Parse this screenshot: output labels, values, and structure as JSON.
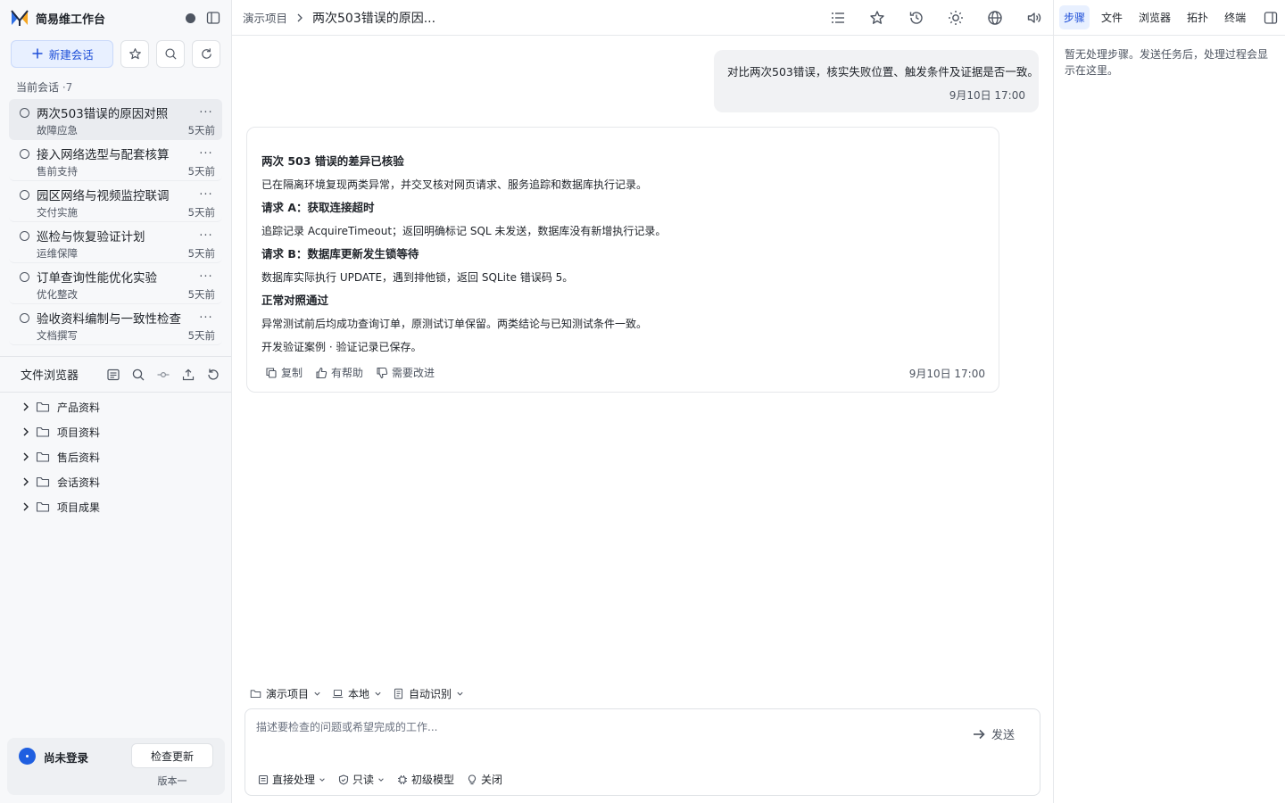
{
  "brand": {
    "name": "简易维工作台"
  },
  "sidebar": {
    "new_chat_label": "新建会话",
    "section_label": "当前会话",
    "section_count": "·7",
    "sessions": [
      {
        "title": "两次503错误的原因对照",
        "tag": "故障应急",
        "time": "5天前",
        "active": true
      },
      {
        "title": "接入网络选型与配套核算",
        "tag": "售前支持",
        "time": "5天前"
      },
      {
        "title": "园区网络与视频监控联调",
        "tag": "交付实施",
        "time": "5天前"
      },
      {
        "title": "巡检与恢复验证计划",
        "tag": "运维保障",
        "time": "5天前"
      },
      {
        "title": "订单查询性能优化实验",
        "tag": "优化整改",
        "time": "5天前"
      },
      {
        "title": "验收资料编制与一致性检查",
        "tag": "文档撰写",
        "time": "5天前"
      }
    ],
    "more_glyph": "···",
    "file_browser": {
      "title": "文件浏览器",
      "folders": [
        "产品资料",
        "项目资料",
        "售后资料",
        "会话资料",
        "项目成果"
      ]
    },
    "user": {
      "name": "尚未登录",
      "update_label": "检查更新",
      "version": "版本一"
    }
  },
  "topbar": {
    "crumb_root": "演示项目",
    "crumb_current": "两次503错误的原因..."
  },
  "chat": {
    "user_message": {
      "text": "对比两次503错误，核实失败位置、触发条件及证据是否一致。",
      "time": "9月10日 17:00"
    },
    "reply": {
      "lines": [
        {
          "text": "两次 503 错误的差异已核验",
          "heading": true
        },
        {
          "text": "已在隔离环境复现两类异常，并交叉核对网页请求、服务追踪和数据库执行记录。"
        },
        {
          "text": "请求 A：获取连接超时",
          "heading": true
        },
        {
          "text": "追踪记录 AcquireTimeout；返回明确标记 SQL 未发送，数据库没有新增执行记录。"
        },
        {
          "text": "请求 B：数据库更新发生锁等待",
          "heading": true
        },
        {
          "text": "数据库实际执行 UPDATE，遇到排他锁，返回 SQLite 错误码 5。"
        },
        {
          "text": "正常对照通过",
          "heading": true
        },
        {
          "text": "异常测试前后均成功查询订单，原测试订单保留。两类结论与已知测试条件一致。"
        },
        {
          "text": "开发验证案例 · 验证记录已保存。"
        }
      ],
      "copy_label": "复制",
      "helpful_label": "有帮助",
      "improve_label": "需要改进",
      "time": "9月10日 17:00"
    },
    "context": {
      "project": "演示项目",
      "location": "本地",
      "detect": "自动识别"
    },
    "composer": {
      "placeholder": "描述要检查的问题或希望完成的工作...",
      "send_label": "发送",
      "mode": "直接处理",
      "permission": "只读",
      "model": "初级模型",
      "toggle": "关闭"
    }
  },
  "right_panel": {
    "tabs": [
      "步骤",
      "文件",
      "浏览器",
      "拓扑",
      "终端"
    ],
    "active_tab": "步骤",
    "empty_text": "暂无处理步骤。发送任务后，处理过程会显示在这里。"
  },
  "colors": {
    "accent": "#1d4ed8",
    "accent_bg": "#e8f0ff",
    "avatar": "#1f5fe0"
  }
}
